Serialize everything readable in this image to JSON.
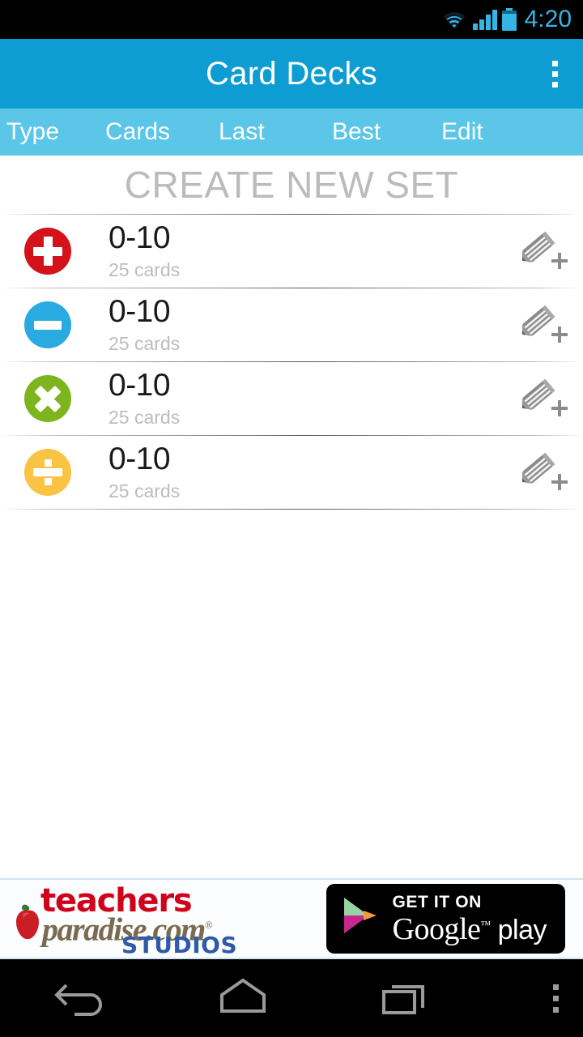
{
  "status_bar": {
    "time": "4:20",
    "icons": [
      "wifi-icon",
      "cellular-signal-icon",
      "battery-icon"
    ],
    "accent_color": "#33B5E5"
  },
  "app_bar": {
    "title": "Card Decks",
    "background_color": "#0D9DD2",
    "overflow_label": "More options"
  },
  "column_header": {
    "background_color": "#5BC6E8",
    "columns": [
      {
        "label": "Type"
      },
      {
        "label": "Cards"
      },
      {
        "label": "Last"
      },
      {
        "label": "Best"
      },
      {
        "label": "Edit"
      }
    ]
  },
  "create_new": {
    "label": "CREATE NEW SET",
    "color": "#BBBBBB"
  },
  "decks": [
    {
      "operation": "addition",
      "icon": "plus-circle-icon",
      "icon_color": "#D4121A",
      "title": "0-10",
      "cards": "25 cards",
      "last": "",
      "best": "",
      "edit_icon": "pencil-add-icon"
    },
    {
      "operation": "subtraction",
      "icon": "minus-circle-icon",
      "icon_color": "#29ABE2",
      "title": "0-10",
      "cards": "25 cards",
      "last": "",
      "best": "",
      "edit_icon": "pencil-add-icon"
    },
    {
      "operation": "multiplication",
      "icon": "multiply-circle-icon",
      "icon_color": "#7DB51E",
      "title": "0-10",
      "cards": "25 cards",
      "last": "",
      "best": "",
      "edit_icon": "pencil-add-icon"
    },
    {
      "operation": "division",
      "icon": "divide-circle-icon",
      "icon_color": "#FAC344",
      "title": "0-10",
      "cards": "25 cards",
      "last": "",
      "best": "",
      "edit_icon": "pencil-add-icon"
    }
  ],
  "ad_banner": {
    "advertiser_line1": "teachers",
    "advertiser_line2": "paradise.com",
    "advertiser_line3": "STUDIOS",
    "registered_mark": "®",
    "logo_icon": "apple-icon",
    "store_badge_top": "GET IT ON",
    "store_badge_brand": "Google",
    "store_badge_trademark": "™",
    "store_badge_product": "play",
    "store_icon": "google-play-triangle-icon"
  },
  "nav_bar": {
    "buttons": [
      {
        "name": "back",
        "icon": "back-arrow-icon"
      },
      {
        "name": "home",
        "icon": "home-icon"
      },
      {
        "name": "recents",
        "icon": "recents-icon"
      },
      {
        "name": "menu",
        "icon": "overflow-menu-icon"
      }
    ]
  }
}
